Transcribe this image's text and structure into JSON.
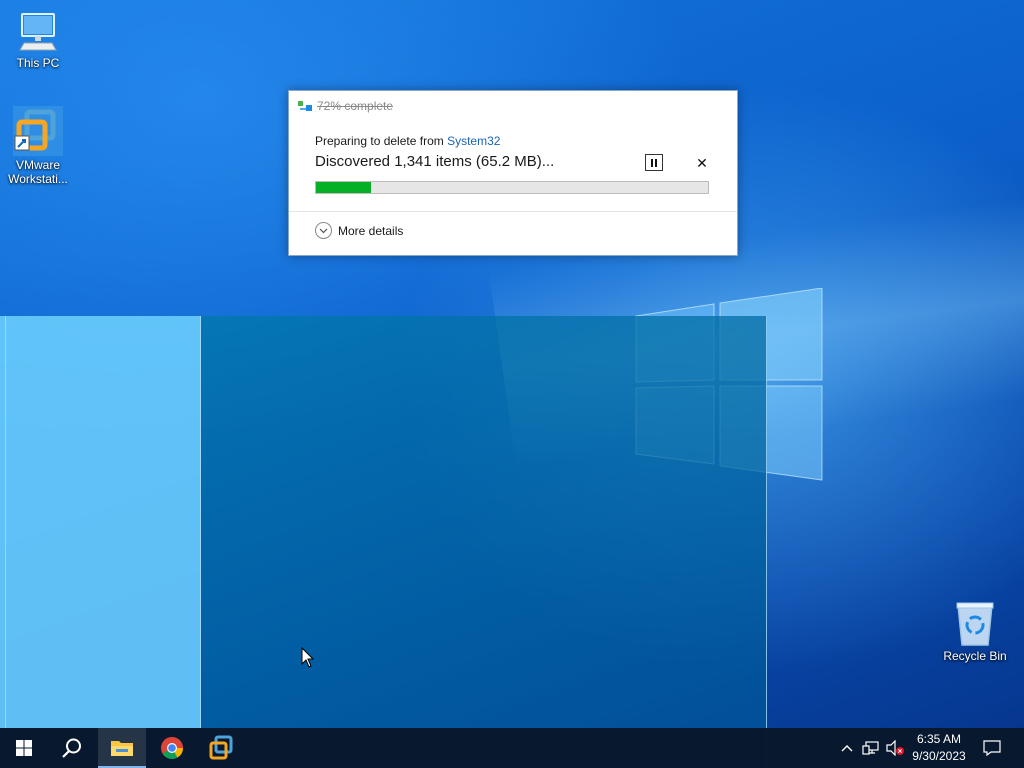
{
  "desktop": {
    "icons": [
      {
        "label": "This PC",
        "icon": "computer-icon"
      },
      {
        "label": "VMware\nWorkstati...",
        "icon": "vmware-icon"
      },
      {
        "label": "Recycle Bin",
        "icon": "recycle-bin-icon"
      }
    ]
  },
  "dialog": {
    "title": "72% complete",
    "preparing_prefix": "Preparing to delete from ",
    "source_link": "System32",
    "status": "Discovered 1,341 items (65.2 MB)...",
    "pause_icon": "pause-icon",
    "close_icon": "close-icon",
    "progress_fraction": 0.14,
    "progress_color": "#06b025",
    "more_details": "More details"
  },
  "taskbar": {
    "buttons": [
      {
        "name": "start-button",
        "icon": "windows-logo-icon"
      },
      {
        "name": "search-button",
        "icon": "search-icon"
      },
      {
        "name": "file-explorer-button",
        "icon": "folder-icon",
        "active": true
      },
      {
        "name": "chrome-button",
        "icon": "chrome-icon"
      },
      {
        "name": "vmware-button",
        "icon": "vmware-icon"
      }
    ],
    "tray": {
      "chevron": "chevron-up-icon",
      "network": "network-icon",
      "volume": "volume-muted-icon",
      "notifications": "notification-icon"
    },
    "clock": {
      "time": "6:35 AM",
      "date": "9/30/2023"
    }
  }
}
